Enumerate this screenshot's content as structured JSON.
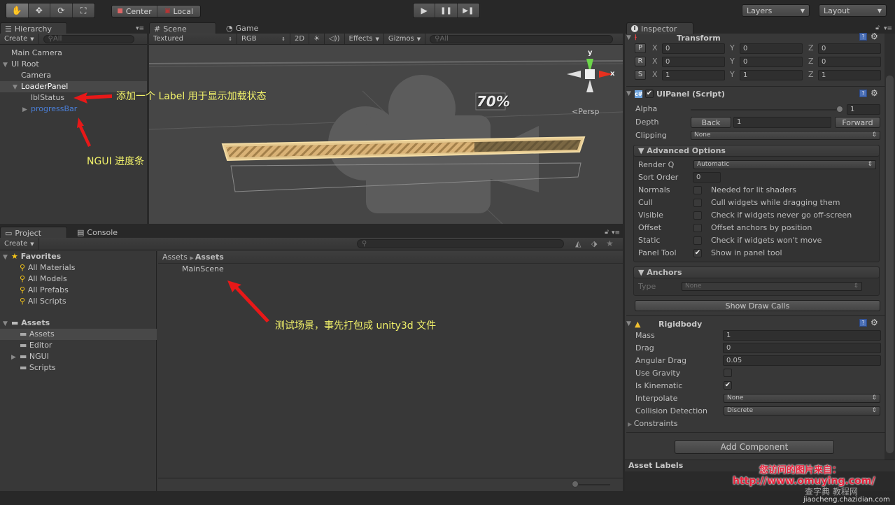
{
  "toolbar": {
    "transform_tools": [
      {
        "name": "hand-tool",
        "icon": "✋"
      },
      {
        "name": "move-tool",
        "icon": "✥"
      },
      {
        "name": "rotate-tool",
        "icon": "⟳"
      },
      {
        "name": "scale-tool",
        "icon": "⛶"
      }
    ],
    "pivot_center": "Center",
    "pivot_local": "Local",
    "play_icon": "▶",
    "pause_icon": "❚❚",
    "step_icon": "▶❚",
    "layers": "Layers",
    "layout": "Layout"
  },
  "hierarchy": {
    "tab": "Hierarchy",
    "create": "Create",
    "search_placeholder": "All",
    "items": [
      {
        "label": "Main Camera",
        "depth": 0,
        "expander": ""
      },
      {
        "label": "UI Root",
        "depth": 0,
        "expander": "▼"
      },
      {
        "label": "Camera",
        "depth": 1,
        "expander": ""
      },
      {
        "label": "LoaderPanel",
        "depth": 1,
        "expander": "▼",
        "selected": true
      },
      {
        "label": "lblStatus",
        "depth": 2,
        "expander": ""
      },
      {
        "label": "progressBar",
        "depth": 2,
        "expander": "▶",
        "prefab": true
      }
    ]
  },
  "scene": {
    "tab_scene": "Scene",
    "tab_game": "Game",
    "shading": "Textured",
    "render_mode": "RGB",
    "mode_2d": "2D",
    "effects": "Effects",
    "gizmos": "Gizmos",
    "search_placeholder": "All",
    "progress_label": "70%",
    "progress_fraction": 0.7,
    "gizmo_y": "y",
    "gizmo_x": "x",
    "projection": "Persp"
  },
  "annotations": {
    "label_note": "添加一个 Label 用于显示加载状态",
    "progress_note": "NGUI 进度条",
    "scene_note": "测试场景，事先打包成 unity3d 文件"
  },
  "project": {
    "tab_project": "Project",
    "tab_console": "Console",
    "create": "Create",
    "favorites_title": "Favorites",
    "favorites": [
      "All Materials",
      "All Models",
      "All Prefabs",
      "All Scripts"
    ],
    "assets_title": "Assets",
    "folders": [
      {
        "label": "Assets",
        "selected": true,
        "expander": ""
      },
      {
        "label": "Editor",
        "expander": ""
      },
      {
        "label": "NGUI",
        "expander": "▶"
      },
      {
        "label": "Scripts",
        "expander": ""
      }
    ],
    "breadcrumb_root": "Assets",
    "breadcrumb_current": "Assets",
    "files": [
      "MainScene"
    ],
    "icon_size_fraction": 0.0
  },
  "inspector": {
    "tab": "Inspector",
    "transform": {
      "title": "Transform",
      "rows": [
        {
          "btn": "P",
          "x": "0",
          "y": "0",
          "z": "0"
        },
        {
          "btn": "R",
          "x": "0",
          "y": "0",
          "z": "0"
        },
        {
          "btn": "S",
          "x": "1",
          "y": "1",
          "z": "1"
        }
      ]
    },
    "uipanel": {
      "title": "UIPanel (Script)",
      "enabled": true,
      "alpha_label": "Alpha",
      "alpha_value": "1",
      "alpha_fraction": 1.0,
      "depth_label": "Depth",
      "back": "Back",
      "depth_value": "1",
      "forward": "Forward",
      "clipping_label": "Clipping",
      "clipping_value": "None",
      "advanced_title": "Advanced Options",
      "render_q_label": "Render Q",
      "render_q_value": "Automatic",
      "sort_order_label": "Sort Order",
      "sort_order_value": "0",
      "options": [
        {
          "label": "Normals",
          "checked": false,
          "desc": "Needed for lit shaders"
        },
        {
          "label": "Cull",
          "checked": false,
          "desc": "Cull widgets while dragging them"
        },
        {
          "label": "Visible",
          "checked": false,
          "desc": "Check if widgets never go off-screen"
        },
        {
          "label": "Offset",
          "checked": false,
          "desc": "Offset anchors by position"
        },
        {
          "label": "Static",
          "checked": false,
          "desc": "Check if widgets won't move"
        },
        {
          "label": "Panel Tool",
          "checked": true,
          "desc": "Show in panel tool"
        }
      ],
      "anchors_title": "Anchors",
      "anchors_type_label": "Type",
      "anchors_type_value": "None",
      "show_draw_calls": "Show Draw Calls"
    },
    "rigidbody": {
      "title": "Rigidbody",
      "mass_label": "Mass",
      "mass": "1",
      "drag_label": "Drag",
      "drag": "0",
      "angular_drag_label": "Angular Drag",
      "angular_drag": "0.05",
      "use_gravity_label": "Use Gravity",
      "use_gravity": false,
      "is_kinematic_label": "Is Kinematic",
      "is_kinematic": true,
      "interpolate_label": "Interpolate",
      "interpolate": "None",
      "collision_label": "Collision Detection",
      "collision": "Discrete",
      "constraints_label": "Constraints"
    },
    "add_component": "Add Component",
    "asset_labels": "Asset Labels"
  },
  "watermark": {
    "line1": "您访问的图片来自：",
    "line2": "http://www.omuying.com/",
    "site": "jiaocheng.chazidian.com",
    "brand": "查字典 教程网"
  },
  "colors": {
    "accent_blue": "#4a7fd8",
    "annotation_yellow": "#f3f36a",
    "arrow_red": "#e81818",
    "progress_gold": "#d9b276"
  }
}
